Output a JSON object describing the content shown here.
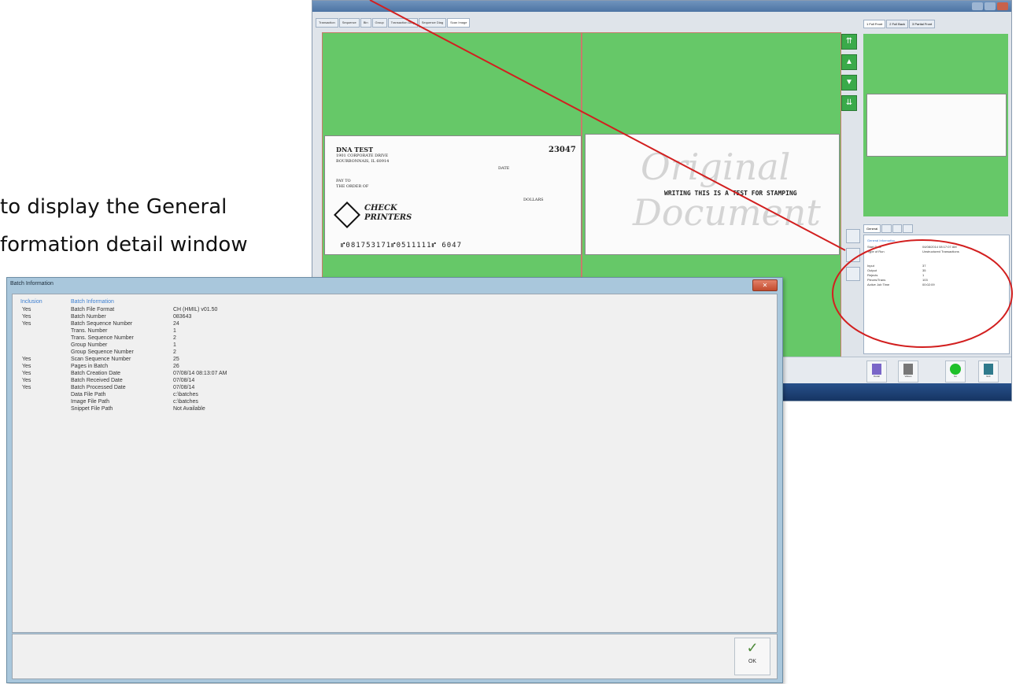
{
  "caption": {
    "line1": "to display the General",
    "line2": "formation detail window"
  },
  "app": {
    "title": "",
    "tabs": [
      "Transaction",
      "Sequence",
      "Bin",
      "Group",
      "Transaction Diag",
      "Sequence Diag",
      "Scan Image"
    ],
    "active_tab_index": 6,
    "nav_buttons": [
      "first",
      "previous",
      "next",
      "last"
    ],
    "right_tabs": [
      "1 Full Front",
      "2 Full Back",
      "3 Partial Front"
    ],
    "info_tabs": [
      "General",
      "",
      "",
      "",
      ""
    ],
    "info_panel": {
      "header": "General Information",
      "rows": [
        {
          "label": "Start Date",
          "value": "04/08/2014 08:17:07 AM"
        },
        {
          "label": "Type of Run",
          "value": "Unstructured Transactions"
        },
        {
          "label": "Input",
          "value": "37"
        },
        {
          "label": "Output",
          "value": "35"
        },
        {
          "label": "Rejects",
          "value": "1"
        },
        {
          "label": "Pieces/Trans",
          "value": "103"
        },
        {
          "label": "Active Job Time",
          "value": "00:02:09"
        }
      ]
    },
    "bottom_buttons": [
      "Detail",
      "Values",
      "Go",
      "Exit"
    ],
    "check_front": {
      "payer": "DNA TEST",
      "address1": "1901 CORPORATE DRIVE",
      "address2": "BOURBONNAIS, IL 60914",
      "check_number": "23047",
      "pay_to": "PAY TO",
      "order_of": "THE ORDER OF",
      "date": "DATE",
      "dollars": "DOLLARS",
      "brand_line1": "CHECK",
      "brand_line2": "PRINTERS",
      "micr": "⑈081753171⑈0511111⑈ 6047"
    },
    "check_back": {
      "watermark1": "Original",
      "watermark2": "Document",
      "stamp": "WRITING THIS IS A TEST FOR STAMPING"
    }
  },
  "dialog": {
    "title": "Batch Information",
    "close_glyph": "✕",
    "headers": {
      "inclusion": "Inclusion",
      "batch": "Batch Information"
    },
    "rows": [
      {
        "inc": "Yes",
        "label": "Batch File Format",
        "value": "CH (HMIL) v01.50"
      },
      {
        "inc": "Yes",
        "label": "Batch Number",
        "value": "083643"
      },
      {
        "inc": "Yes",
        "label": "Batch Sequence Number",
        "value": "24"
      },
      {
        "inc": "",
        "label": "Trans. Number",
        "value": "1"
      },
      {
        "inc": "",
        "label": "Trans. Sequence Number",
        "value": "2"
      },
      {
        "inc": "",
        "label": "Group Number",
        "value": "1"
      },
      {
        "inc": "",
        "label": "Group Sequence Number",
        "value": "2"
      },
      {
        "inc": "Yes",
        "label": "Scan Sequence Number",
        "value": "25"
      },
      {
        "inc": "Yes",
        "label": "Pages in Batch",
        "value": "26"
      },
      {
        "inc": "Yes",
        "label": "Batch Creation Date",
        "value": "07/08/14 08:13:07 AM"
      },
      {
        "inc": "Yes",
        "label": "Batch Received Date",
        "value": "07/08/14"
      },
      {
        "inc": "Yes",
        "label": "Batch Processed Date",
        "value": "07/08/14"
      },
      {
        "inc": "",
        "label": "Data File Path",
        "value": "c:\\batches"
      },
      {
        "inc": "",
        "label": "Image File Path",
        "value": "c:\\batches"
      },
      {
        "inc": "",
        "label": "Snippet File Path",
        "value": "Not Available"
      }
    ],
    "ok_label": "OK",
    "ok_glyph": "✓"
  },
  "colors": {
    "image_background": "#66c868",
    "callout": "#d21f1f",
    "header_blue": "#3a7dd0"
  }
}
